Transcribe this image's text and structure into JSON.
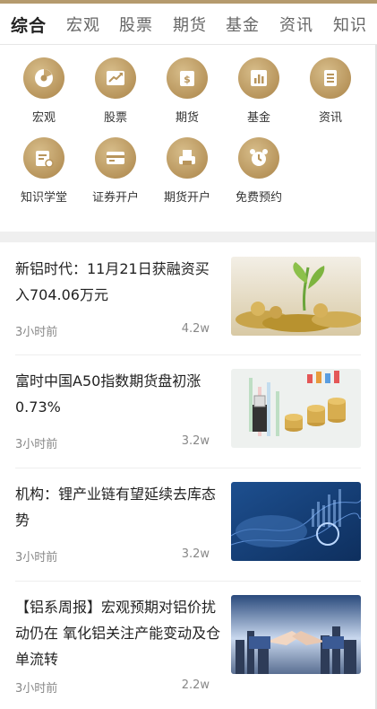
{
  "tabs": [
    "综合",
    "宏观",
    "股票",
    "期货",
    "基金",
    "资讯",
    "知识"
  ],
  "grid": [
    {
      "label": "宏观",
      "icon": "chart-disc-icon"
    },
    {
      "label": "股票",
      "icon": "trend-chart-icon"
    },
    {
      "label": "期货",
      "icon": "money-bag-icon"
    },
    {
      "label": "基金",
      "icon": "bar-chart-icon"
    },
    {
      "label": "资讯",
      "icon": "document-icon"
    },
    {
      "label": "知识学堂",
      "icon": "learning-icon"
    },
    {
      "label": "证券开户",
      "icon": "card-icon"
    },
    {
      "label": "期货开户",
      "icon": "printer-icon"
    },
    {
      "label": "免费预约",
      "icon": "alarm-clock-icon"
    }
  ],
  "articles": [
    {
      "title": "新铝时代：11月21日获融资买入704.06万元",
      "time": "3小时前",
      "views": "4.2w",
      "thumb": "plant-coins-image"
    },
    {
      "title": "富时中国A50指数期货盘初涨0.73%",
      "time": "3小时前",
      "views": "3.2w",
      "thumb": "coins-chart-image"
    },
    {
      "title": "机构：锂产业链有望延续去库态势",
      "time": "3小时前",
      "views": "3.2w",
      "thumb": "banknotes-chart-image"
    },
    {
      "title": "【铝系周报】宏观预期对铝价扰动仍在 氧化铝关注产能变动及仓单流转",
      "time": "3小时前",
      "views": "2.2w",
      "thumb": "handshake-city-image"
    }
  ]
}
